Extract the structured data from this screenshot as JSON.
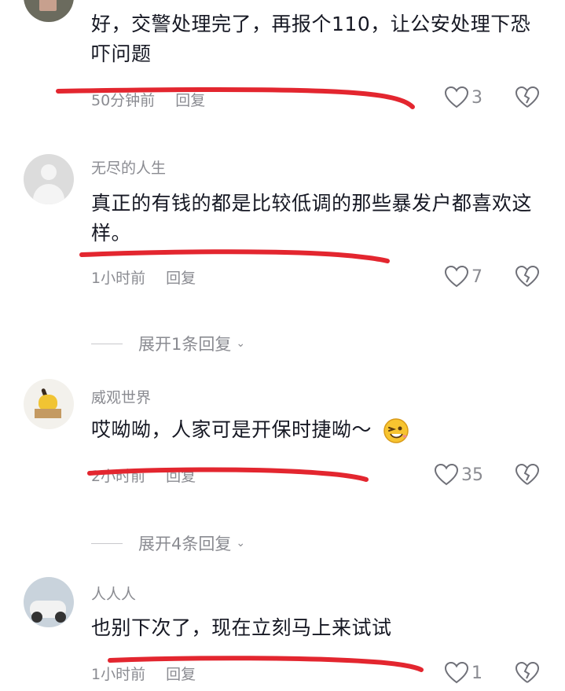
{
  "comments": [
    {
      "username": "",
      "text": "好，交警处理完了，再报个110，让公安处理下恐吓问题",
      "time": "50分钟前",
      "reply": "回复",
      "likes": "3"
    },
    {
      "username": "无尽的人生",
      "text": "真正的有钱的都是比较低调的那些暴发户都喜欢这样。",
      "time": "1小时前",
      "reply": "回复",
      "likes": "7",
      "expand": "展开1条回复"
    },
    {
      "username": "威观世界",
      "text": "哎呦呦，人家可是开保时捷呦～",
      "time": "2小时前",
      "reply": "回复",
      "likes": "35",
      "expand": "展开4条回复"
    },
    {
      "username": "人人人",
      "text": "也别下次了，现在立刻马上来试试",
      "time": "1小时前",
      "reply": "回复",
      "likes": "1"
    }
  ],
  "colors": {
    "annotation_red": "#e3262f",
    "text_primary": "#161823",
    "text_secondary": "#8a8b91"
  },
  "icons": [
    "heart-outline-icon",
    "dislike-broken-heart-icon",
    "wink-emoji-icon",
    "chevron-down-icon"
  ]
}
